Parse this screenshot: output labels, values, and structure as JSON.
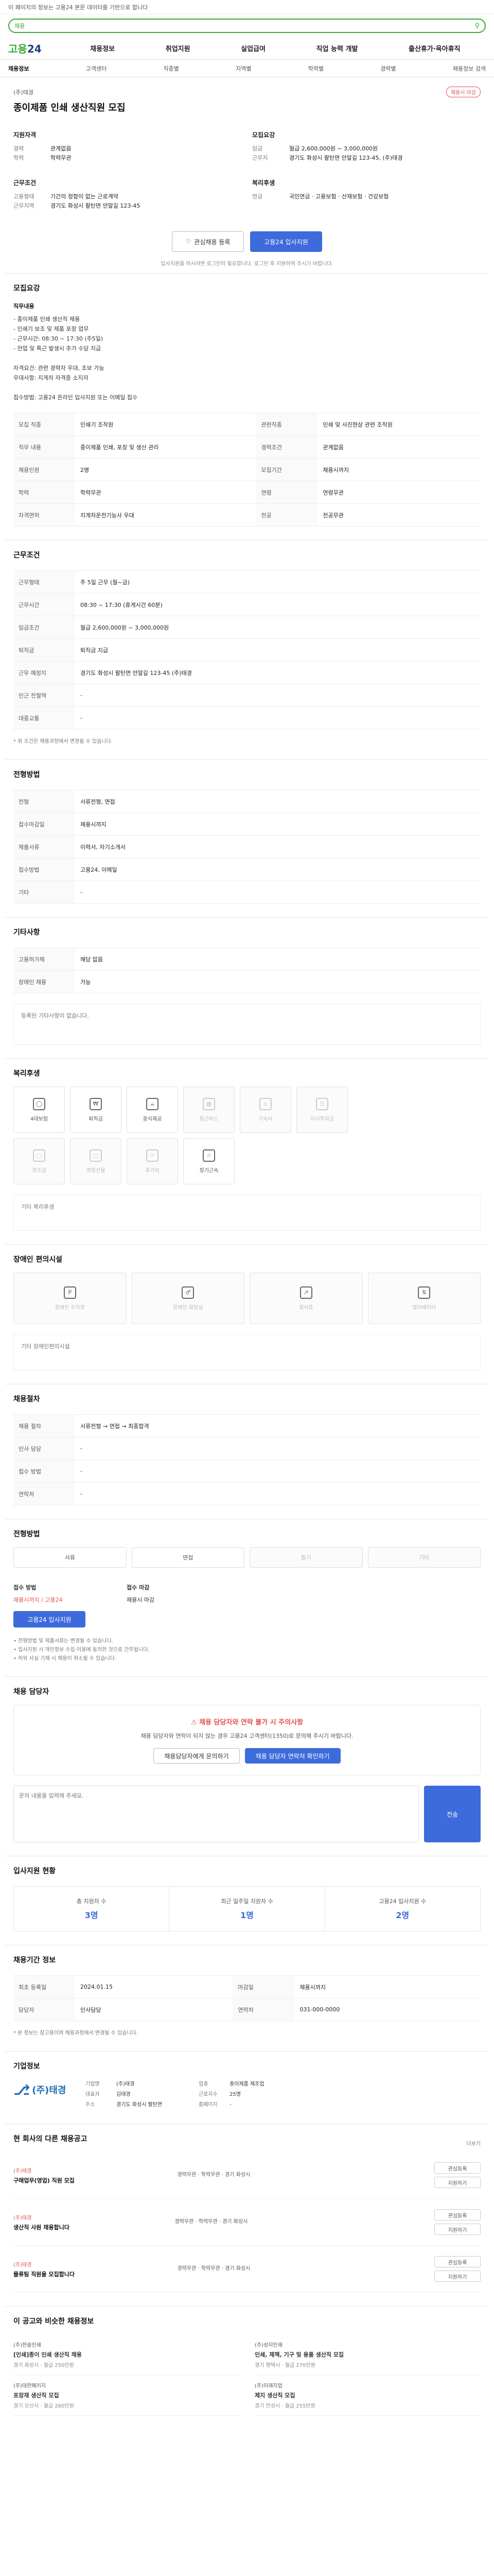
{
  "notice": "이 페이지의 정보는 고용24 본문 데이터를 기반으로 합니다",
  "search": {
    "tag": "채용",
    "placeholder": ""
  },
  "gnb": {
    "logo_main": "고용",
    "logo_sub": "24",
    "menu": [
      "채용정보",
      "취업지원",
      "실업급여",
      "직업 능력 개발",
      "출산휴가·육아휴직"
    ]
  },
  "subnav": [
    "채용정보",
    "고객센터",
    "직종별",
    "지역별",
    "학력별",
    "경력별",
    "채용정보 검색"
  ],
  "job": {
    "company": "(주)태경",
    "title": "종이제품 인쇄 생산직원 모집",
    "badge": "채용시 마감",
    "left_title": "지원자격",
    "left": [
      {
        "k": "경력",
        "v": "관계없음"
      },
      {
        "k": "학력",
        "v": "학력무관"
      }
    ],
    "left2_title": "근무조건",
    "left2": [
      {
        "k": "고용형태",
        "v": "기간의 정함이 없는 근로계약"
      },
      {
        "k": "근무지역",
        "v": "경기도 화성시 팔탄면 안말길 123-45"
      }
    ],
    "right_title": "모집요강",
    "right": [
      {
        "k": "임금",
        "v": "월급 2,600,000원 ~ 3,000,000원"
      },
      {
        "k": "근무지",
        "v": "경기도 화성시 팔탄면 안말길 123-45, (주)태경"
      }
    ],
    "right2_title": "복리후생",
    "right2": [
      {
        "k": "연금",
        "v": "국민연금 · 고용보험 · 산재보험 · 건강보험"
      }
    ],
    "btn_save": "관심채용 등록",
    "btn_apply": "고용24 입사지원",
    "note_small": "입사지원을 하시려면 로그인이 필요합니다. 로그인 후 지원하여 주시기 바랍니다."
  },
  "detail": {
    "title": "모집요강",
    "label_main": "직무내용",
    "body": "- 종이제품 인쇄 생산직 채용\n- 인쇄기 보조 및 제품 포장 업무\n- 근무시간: 08:30 ~ 17:30 (주5일)\n- 잔업 및 특근 발생시 추가 수당 지급\n\n자격요건: 관련 경력자 우대, 초보 가능\n우대사항: 지게차 자격증 소지자\n\n접수방법: 고용24 온라인 입사지원 또는 이메일 접수"
  },
  "info_table": {
    "rows": [
      [
        {
          "k": "모집 직종",
          "v": "인쇄기 조작원"
        },
        {
          "k": "관련직종",
          "v": "인쇄 및 사진현상 관련 조작원"
        }
      ],
      [
        {
          "k": "직무 내용",
          "v": "종이제품 인쇄, 포장 및 생산 관리"
        },
        {
          "k": "경력조건",
          "v": "관계없음"
        }
      ],
      [
        {
          "k": "채용인원",
          "v": "2명"
        },
        {
          "k": "모집기간",
          "v": "채용시까지"
        }
      ],
      [
        {
          "k": "학력",
          "v": "학력무관"
        },
        {
          "k": "연령",
          "v": "연령무관"
        }
      ],
      [
        {
          "k": "자격면허",
          "v": "지게차운전기능사 우대"
        },
        {
          "k": "전공",
          "v": "전공무관"
        }
      ]
    ]
  },
  "conditions": {
    "title": "근무조건",
    "rows": [
      {
        "k": "근무형태",
        "v": "주 5일 근무 (월~금)"
      },
      {
        "k": "근무시간",
        "v": "08:30 ~ 17:30 (휴게시간 60분)"
      },
      {
        "k": "임금조건",
        "v": "월급 2,600,000원 ~ 3,000,000원"
      },
      {
        "k": "퇴직금",
        "v": "퇴직금 지급"
      },
      {
        "k": "근무 예정지",
        "v": "경기도 화성시 팔탄면 안말길 123-45 (주)태경"
      },
      {
        "k": "인근 전철역",
        "v": "-"
      },
      {
        "k": "대중교통",
        "v": "-"
      }
    ],
    "foot": "* 위 조건은 채용과정에서 변경될 수 있습니다."
  },
  "contact": {
    "title": "전형방법",
    "rows": [
      {
        "k": "전형",
        "v": "서류전형, 면접"
      },
      {
        "k": "접수마감일",
        "v": "채용시까지"
      },
      {
        "k": "제출서류",
        "v": "이력서, 자기소개서"
      },
      {
        "k": "접수방법",
        "v": "고용24, 이메일"
      },
      {
        "k": "기타",
        "v": "-"
      }
    ]
  },
  "other": {
    "title": "기타사항",
    "rows": [
      {
        "k": "고용허가제",
        "v": "해당 없음"
      },
      {
        "k": "장애인 채용",
        "v": "가능"
      }
    ],
    "empty_note": "등록된 기타사항이 없습니다."
  },
  "welfare": {
    "title": "복리후생",
    "items": [
      {
        "label": "4대보험",
        "icon": "shield",
        "on": true
      },
      {
        "label": "퇴직금",
        "icon": "coin",
        "on": true
      },
      {
        "label": "중식제공",
        "icon": "meal",
        "on": true
      },
      {
        "label": "통근버스",
        "icon": "bus",
        "on": false
      },
      {
        "label": "기숙사",
        "icon": "home",
        "on": false
      },
      {
        "label": "자녀학자금",
        "icon": "book",
        "on": false
      },
      {
        "label": "경조금",
        "icon": "gift",
        "on": false
      },
      {
        "label": "명절선물",
        "icon": "gift",
        "on": false
      },
      {
        "label": "휴가비",
        "icon": "sun",
        "on": false
      },
      {
        "label": "장기근속",
        "icon": "star",
        "on": true
      }
    ],
    "note": "기타 복리후생"
  },
  "disabled": {
    "title": "장애인 편의시설",
    "items": [
      "장애인 주차장",
      "장애인 화장실",
      "경사로",
      "엘리베이터"
    ],
    "note": "기타 장애인편의시설"
  },
  "workplace": {
    "title": "채용절차",
    "rows": [
      {
        "k": "채용 절차",
        "v": "서류전형 → 면접 → 최종합격"
      },
      {
        "k": "인사 담당",
        "v": "-"
      },
      {
        "k": "접수 방법",
        "v": "-"
      },
      {
        "k": "연락처",
        "v": "-"
      }
    ]
  },
  "process": {
    "title": "전형방법",
    "steps": [
      {
        "label": "서류",
        "on": true
      },
      {
        "label": "면접",
        "on": true
      },
      {
        "label": "필기",
        "on": false
      },
      {
        "label": "기타",
        "on": false
      }
    ],
    "apply_title": "접수 방법",
    "apply_text": "채용시까지 / 고용24",
    "apply_btn": "고용24 입사지원",
    "contact_title": "접수 마감",
    "contact_text": "채용시 마감",
    "bullets": [
      "• 전형방법 및 제출서류는 변경될 수 있습니다.",
      "• 입사지원 시 개인정보 수집·이용에 동의한 것으로 간주됩니다.",
      "• 허위 사실 기재 시 채용이 취소될 수 있습니다."
    ]
  },
  "warning": {
    "title": "채용 담당자",
    "alert_title": "채용 담당자와 연락 불가 시 주의사항",
    "alert_text": "채용 담당자와 연락이 되지 않는 경우 고용24 고객센터(1350)로 문의해 주시기 바랍니다.",
    "btn1": "채용담당자에게 문의하기",
    "btn2": "채용 담당자 연락처 확인하기",
    "inquiry_placeholder": "문의 내용을 입력해 주세요.",
    "inquiry_send": "전송"
  },
  "stats": {
    "title": "입사지원 현황",
    "items": [
      {
        "label": "총 지원자 수",
        "num": "3명"
      },
      {
        "label": "최근 일주일 지원자 수",
        "num": "1명"
      },
      {
        "label": "고용24 입사지원 수",
        "num": "2명"
      }
    ]
  },
  "meta_info": {
    "title": "채용기간 정보",
    "rows": [
      [
        {
          "k": "최초 등록일",
          "v": "2024.01.15"
        },
        {
          "k": "마감일",
          "v": "채용시까지"
        }
      ],
      [
        {
          "k": "담당자",
          "v": "인사담당"
        },
        {
          "k": "연락처",
          "v": "031-000-0000"
        }
      ]
    ],
    "foot": "* 본 정보는 참고용이며 채용과정에서 변경될 수 있습니다."
  },
  "company": {
    "title": "기업정보",
    "logo_text": "(주)태경",
    "fields": [
      {
        "k": "기업명",
        "v": "(주)태경"
      },
      {
        "k": "업종",
        "v": "종이제품 제조업"
      },
      {
        "k": "대표자",
        "v": "김태경"
      },
      {
        "k": "근로자수",
        "v": "25명"
      },
      {
        "k": "주소",
        "v": "경기도 화성시 팔탄면"
      },
      {
        "k": "홈페이지",
        "v": "-"
      }
    ]
  },
  "similar": {
    "title": "현 회사의 다른 채용공고",
    "more": "더보기",
    "items": [
      {
        "company": "(주)태경",
        "title": "구매업무(영업) 직원 모집",
        "meta": "경력무관 · 학력무관 · 경기 화성시",
        "btn1": "관심등록",
        "btn2": "지원하기"
      },
      {
        "company": "(주)태경",
        "title": "생산직 사원 채용합니다",
        "meta": "경력무관 · 학력무관 · 경기 화성시",
        "btn1": "관심등록",
        "btn2": "지원하기"
      },
      {
        "company": "(주)태경",
        "title": "물류팀 직원을 모집합니다",
        "meta": "경력무관 · 학력무관 · 경기 화성시",
        "btn1": "관심등록",
        "btn2": "지원하기"
      }
    ]
  },
  "recommended": {
    "title": "이 공고와 비슷한 채용정보",
    "left": [
      {
        "cn": "(주)한솔인쇄",
        "tt": "[인쇄]종이 인쇄 생산직 채용",
        "meta": "경기 화성시 · 월급 250만원"
      },
      {
        "cn": "(주)대한패키지",
        "tt": "포장재 생산직 모집",
        "meta": "경기 오산시 · 월급 260만원"
      }
    ],
    "right": [
      {
        "cn": "(주)성지인쇄",
        "tt": "인쇄, 제책, 기구 및 용품 생산직 모집",
        "meta": "경기 평택시 · 월급 270만원"
      },
      {
        "cn": "(주)미래지업",
        "tt": "제지 생산직 모집",
        "meta": "경기 안성시 · 월급 255만원"
      }
    ]
  }
}
